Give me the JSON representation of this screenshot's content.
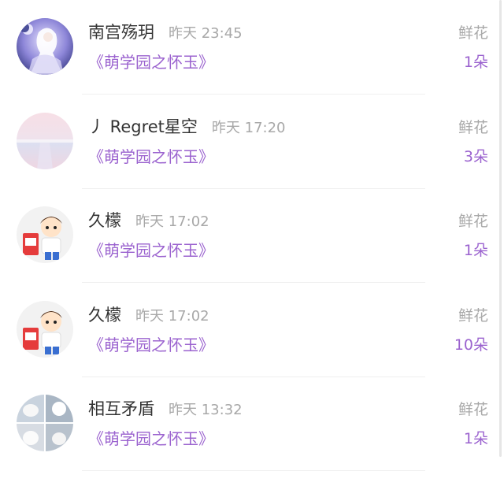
{
  "items": [
    {
      "username": "南宫殇玥",
      "time": "昨天 23:45",
      "book": "《萌学园之怀玉》",
      "gift_type": "鲜花",
      "count": "1朵",
      "avatar": "anime-girl-avatar"
    },
    {
      "username": "丿 Regret星空",
      "time": "昨天 17:20",
      "book": "《萌学园之怀玉》",
      "gift_type": "鲜花",
      "count": "3朵",
      "avatar": "pastel-landscape-avatar"
    },
    {
      "username": "久檬",
      "time": "昨天 17:02",
      "book": "《萌学园之怀玉》",
      "gift_type": "鲜花",
      "count": "1朵",
      "avatar": "cartoon-boy-avatar"
    },
    {
      "username": "久檬",
      "time": "昨天 17:02",
      "book": "《萌学园之怀玉》",
      "gift_type": "鲜花",
      "count": "10朵",
      "avatar": "cartoon-boy-avatar"
    },
    {
      "username": "相互矛盾",
      "time": "昨天 13:32",
      "book": "《萌学园之怀玉》",
      "gift_type": "鲜花",
      "count": "1朵",
      "avatar": "white-animals-grid-avatar"
    }
  ],
  "colors": {
    "accent": "#9b63cf",
    "name": "#333333",
    "muted": "#a8a8a8",
    "divider": "#efefef"
  }
}
